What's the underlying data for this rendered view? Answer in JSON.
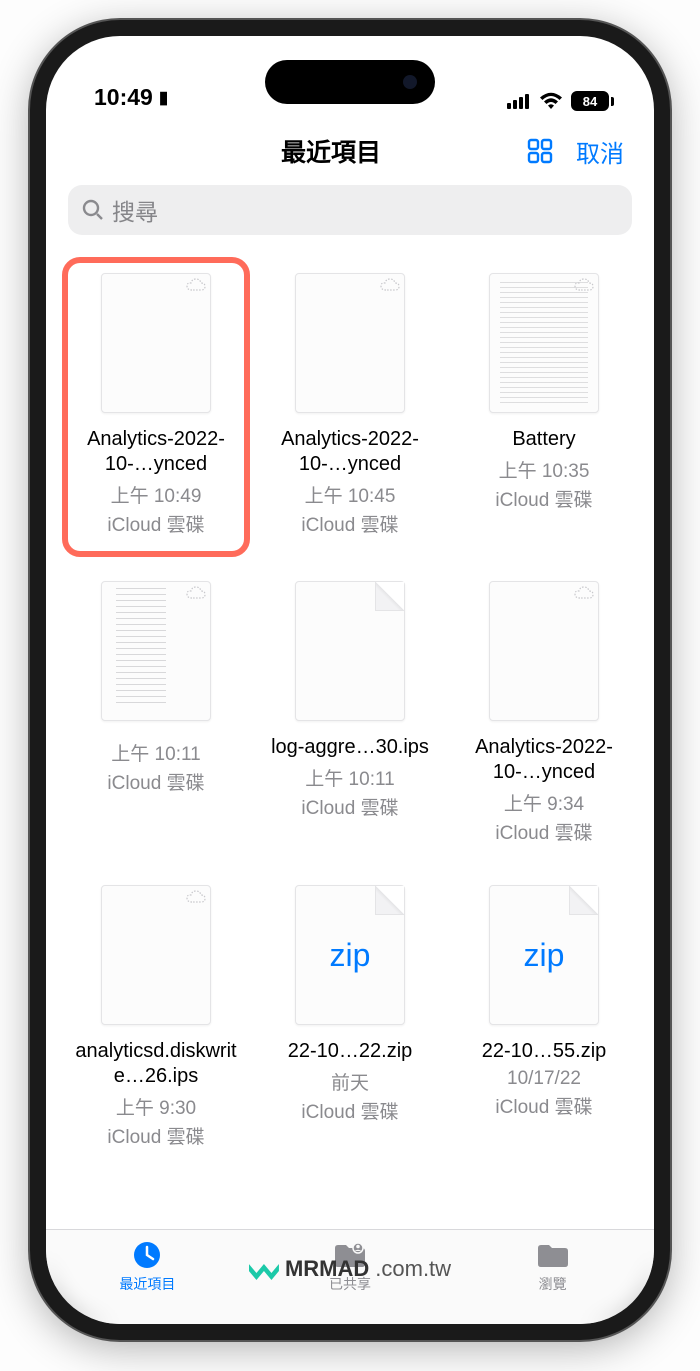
{
  "statusbar": {
    "time": "10:49",
    "battery": "84"
  },
  "nav": {
    "title": "最近項目",
    "cancel": "取消"
  },
  "search": {
    "placeholder": "搜尋"
  },
  "files": [
    {
      "name": "Analytics-2022-10-…ynced",
      "time": "上午 10:49",
      "loc": "iCloud 雲碟",
      "thumb": "blank-cloud",
      "highlighted": true
    },
    {
      "name": "Analytics-2022-10-…ynced",
      "time": "上午 10:45",
      "loc": "iCloud 雲碟",
      "thumb": "blank-cloud"
    },
    {
      "name": "Battery",
      "time": "上午 10:35",
      "loc": "iCloud 雲碟",
      "thumb": "text-doc-cloud"
    },
    {
      "name": "",
      "time": "上午 10:11",
      "loc": "iCloud 雲碟",
      "thumb": "list-doc-cloud"
    },
    {
      "name": "log-aggre…30.ips",
      "time": "上午 10:11",
      "loc": "iCloud 雲碟",
      "thumb": "fold"
    },
    {
      "name": "Analytics-2022-10-…ynced",
      "time": "上午 9:34",
      "loc": "iCloud 雲碟",
      "thumb": "blank-cloud"
    },
    {
      "name": "analyticsd.diskwrite…26.ips",
      "time": "上午 9:30",
      "loc": "iCloud 雲碟",
      "thumb": "blank-cloud"
    },
    {
      "name": "22-10…22.zip",
      "time": "前天",
      "loc": "iCloud 雲碟",
      "thumb": "zip"
    },
    {
      "name": "22-10…55.zip",
      "time": "10/17/22",
      "loc": "iCloud 雲碟",
      "thumb": "zip"
    }
  ],
  "tabs": {
    "recents": "最近項目",
    "shared": "已共享",
    "browse": "瀏覽"
  },
  "watermark": {
    "brand": "MRMAD",
    "domain": ".com.tw"
  },
  "zip_label": "zip"
}
